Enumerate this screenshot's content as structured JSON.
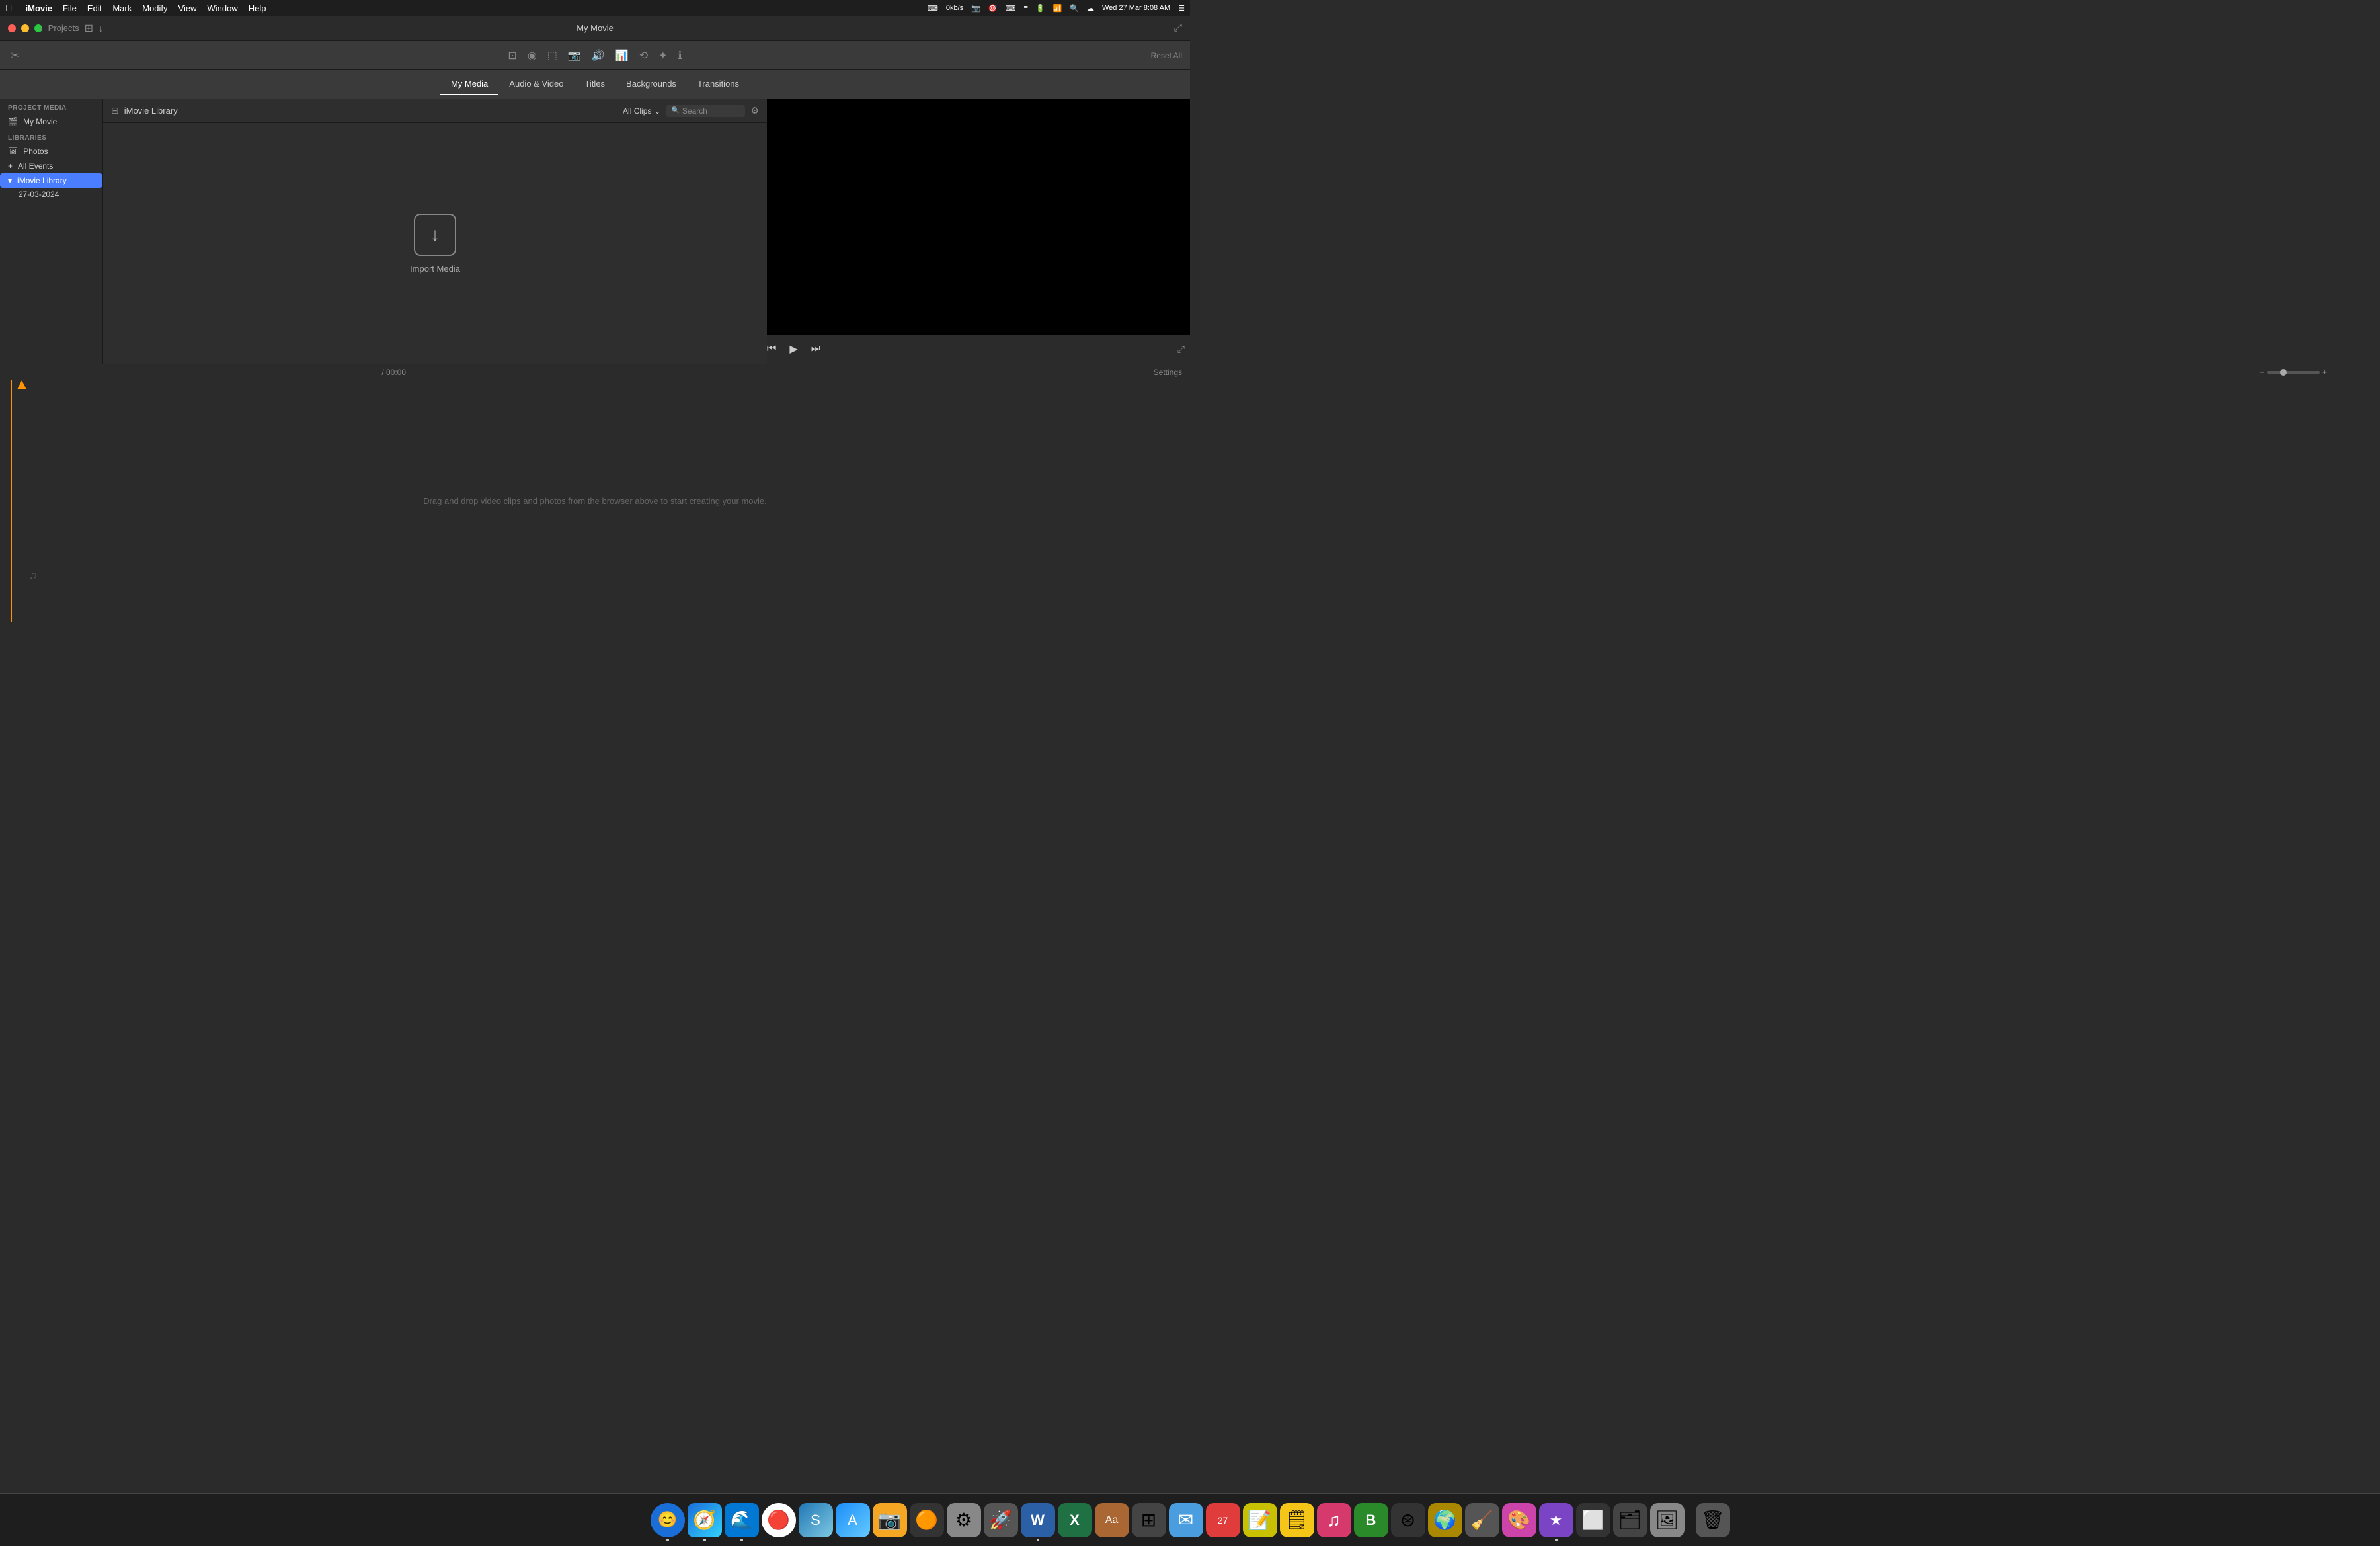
{
  "menubar": {
    "apple": "&#63743;",
    "app_name": "iMovie",
    "items": [
      "File",
      "Edit",
      "Mark",
      "Modify",
      "View",
      "Window",
      "Help"
    ],
    "right": {
      "network": "0kb/s",
      "datetime": "Wed 27 Mar  8:08 AM"
    }
  },
  "titlebar": {
    "title": "My Movie",
    "projects_label": "Projects",
    "back_arrow": "‹"
  },
  "viewer_toolbar": {
    "scissors_icon": "✂",
    "buttons": [
      "⊡",
      "⊕",
      "⬜",
      "📷",
      "🔊",
      "📊",
      "⟲",
      "✦",
      "ℹ"
    ],
    "reset_label": "Reset All"
  },
  "content_tabs": {
    "tabs": [
      "My Media",
      "Audio & Video",
      "Titles",
      "Backgrounds",
      "Transitions"
    ],
    "active": "My Media"
  },
  "media_browser": {
    "library_name": "iMovie Library",
    "all_clips_label": "All Clips",
    "search_placeholder": "Search",
    "import_label": "Import Media"
  },
  "sidebar": {
    "project_media_label": "PROJECT MEDIA",
    "my_movie_label": "My Movie",
    "libraries_label": "LIBRARIES",
    "items": [
      {
        "id": "photos",
        "label": "Photos",
        "icon": "🖼"
      },
      {
        "id": "all-events",
        "label": "All Events",
        "icon": "+"
      },
      {
        "id": "imovie-library",
        "label": "iMovie Library",
        "icon": "v",
        "active": true
      },
      {
        "id": "date",
        "label": "27-03-2024",
        "indent": true
      }
    ]
  },
  "timeline": {
    "time_label": "/ 00:00",
    "settings_label": "Settings",
    "hint_text": "Drag and drop video clips and photos from the browser above to start creating your movie.",
    "zoom_min": "−",
    "zoom_max": "+"
  },
  "preview": {
    "controls": {
      "skip_back": "⏮",
      "play": "▶",
      "skip_forward": "⏭"
    }
  },
  "dock": {
    "items": [
      {
        "id": "finder",
        "bg": "#1a6ed8",
        "label": "Finder",
        "symbol": "🔵",
        "active": true
      },
      {
        "id": "safari",
        "bg": "#1a6ed8",
        "label": "Safari",
        "symbol": "🌐",
        "active": true
      },
      {
        "id": "edge",
        "bg": "#0078d4",
        "label": "Edge",
        "symbol": "🌊",
        "active": true
      },
      {
        "id": "chrome",
        "bg": "#ea4335",
        "label": "Chrome",
        "symbol": "🔴",
        "active": true
      },
      {
        "id": "skype",
        "bg": "#00aff0",
        "label": "Skype",
        "symbol": "💬",
        "active": false
      },
      {
        "id": "appstore",
        "bg": "#1c8ef9",
        "label": "App Store",
        "symbol": "🅰",
        "active": false
      },
      {
        "id": "snagit",
        "bg": "#e8a000",
        "label": "SnagIt",
        "symbol": "📷",
        "active": false
      },
      {
        "id": "vlc",
        "bg": "#ff8800",
        "label": "VLC",
        "symbol": "🟠",
        "active": false
      },
      {
        "id": "sysprefs",
        "bg": "#888",
        "label": "System Preferences",
        "symbol": "⚙",
        "active": false
      },
      {
        "id": "launchpad",
        "bg": "#555",
        "label": "Launchpad",
        "symbol": "🚀",
        "active": false
      },
      {
        "id": "word",
        "bg": "#2b5fa6",
        "label": "Word",
        "symbol": "W",
        "active": true
      },
      {
        "id": "excel",
        "bg": "#1f7144",
        "label": "Excel",
        "symbol": "X",
        "active": false
      },
      {
        "id": "dict",
        "bg": "#aa6633",
        "label": "Dictionary",
        "symbol": "Aa",
        "active": false
      },
      {
        "id": "appstore2",
        "bg": "#1c8ef9",
        "label": "App Store",
        "symbol": "⊞",
        "active": false
      },
      {
        "id": "mail",
        "bg": "#4a9ee0",
        "label": "Mail",
        "symbol": "✉",
        "active": false
      },
      {
        "id": "calendar",
        "bg": "#e03c3c",
        "label": "Calendar",
        "symbol": "📅",
        "active": false
      },
      {
        "id": "launchpad2",
        "bg": "#444",
        "label": "Launchpad",
        "symbol": "⊞",
        "active": false
      },
      {
        "id": "notes",
        "bg": "#c8a000",
        "label": "Notes",
        "symbol": "📝",
        "active": false
      },
      {
        "id": "stickies",
        "bg": "#f5c518",
        "label": "Stickies",
        "symbol": "🗒",
        "active": false
      },
      {
        "id": "music",
        "bg": "#d63a6c",
        "label": "Music",
        "symbol": "♫",
        "active": false
      },
      {
        "id": "budgetb",
        "bg": "#2a8a2a",
        "label": "Budget",
        "symbol": "B",
        "active": false
      },
      {
        "id": "instruments",
        "bg": "#333",
        "label": "Instruments",
        "symbol": "⊛",
        "active": false
      },
      {
        "id": "unknown1",
        "bg": "#aa8800",
        "label": "App",
        "symbol": "🌍",
        "active": false
      },
      {
        "id": "unknown2",
        "bg": "#888",
        "label": "CleanMyMac",
        "symbol": "🧹",
        "active": false
      },
      {
        "id": "unknown3",
        "bg": "#cc44aa",
        "label": "App",
        "symbol": "🎨",
        "active": false
      },
      {
        "id": "imovie",
        "bg": "#7b44c4",
        "label": "iMovie",
        "symbol": "★",
        "active": true
      },
      {
        "id": "unknown4",
        "bg": "#333",
        "label": "App",
        "symbol": "⬜",
        "active": false
      },
      {
        "id": "unknown5",
        "bg": "#444",
        "label": "App",
        "symbol": "🗂",
        "active": false
      },
      {
        "id": "preview",
        "bg": "#888",
        "label": "Preview",
        "symbol": "🖼",
        "active": false
      },
      {
        "id": "trash",
        "bg": "#555",
        "label": "Trash",
        "symbol": "🗑",
        "active": false
      }
    ]
  }
}
